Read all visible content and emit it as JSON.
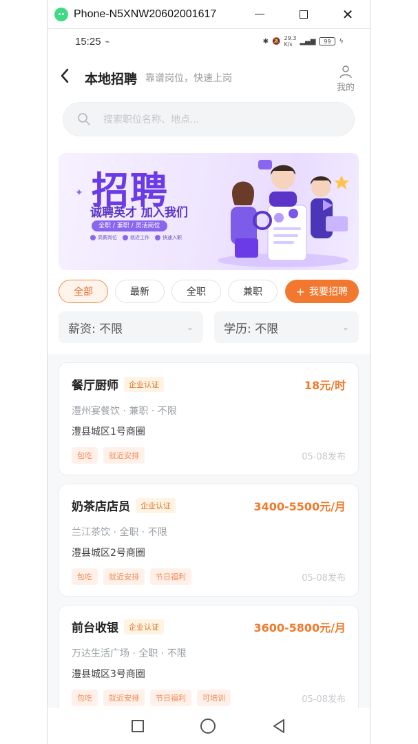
{
  "window": {
    "title": "Phone-N5XNW20602001617",
    "min_icon": "minimize-icon",
    "max_icon": "maximize-icon",
    "close_glyph": "✕"
  },
  "status": {
    "time": "15:25",
    "speed": "29.3\nK/s",
    "battery": "99"
  },
  "header": {
    "title": "本地招聘",
    "subtitle": "靠谱岗位，快速上岗",
    "me_label": "我的"
  },
  "search": {
    "placeholder": "搜索职位名称、地点..."
  },
  "banner": {
    "title": "招聘",
    "subtitle": "诚聘英才 加入我们",
    "tags": "全职 / 兼职 / 灵活岗位",
    "features": [
      "高薪岗位",
      "就近工作",
      "快速入职"
    ],
    "colors": {
      "accent": "#6a3be6"
    }
  },
  "filters": {
    "chips": [
      "全部",
      "最新",
      "全职",
      "兼职"
    ],
    "active_index": 0,
    "recruit_label": "我要招聘"
  },
  "dropdowns": {
    "salary": "薪资: 不限",
    "education": "学历: 不限"
  },
  "jobs": [
    {
      "title": "餐厅厨师",
      "badge": "企业认证",
      "salary": "18元/时",
      "company": "澧州宴餐饮 · 兼职 · 不限",
      "location": "澧县城区1号商圈",
      "tags": [
        "包吃",
        "就近安排"
      ],
      "posted": "05-08发布"
    },
    {
      "title": "奶茶店店员",
      "badge": "企业认证",
      "salary": "3400-5500元/月",
      "company": "兰江茶饮 · 全职 · 不限",
      "location": "澧县城区2号商圈",
      "tags": [
        "包吃",
        "就近安排",
        "节日福利"
      ],
      "posted": "05-08发布"
    },
    {
      "title": "前台收银",
      "badge": "企业认证",
      "salary": "3600-5800元/月",
      "company": "万达生活广场 · 全职 · 不限",
      "location": "澧县城区3号商圈",
      "tags": [
        "包吃",
        "就近安排",
        "节日福利",
        "可培训"
      ],
      "posted": "05-08发布"
    }
  ],
  "colors": {
    "orange": "#f2782f",
    "purple": "#6a3be6"
  }
}
